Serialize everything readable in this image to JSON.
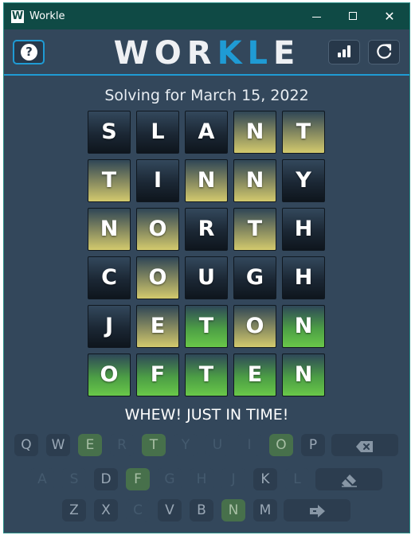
{
  "window": {
    "title": "Workle",
    "app_icon_letter": "W",
    "controls": {
      "minimize": "",
      "maximize": "",
      "close": "✕"
    }
  },
  "header": {
    "logo_part1": "WOR",
    "logo_part2": "KL",
    "logo_part3": "E",
    "help_label": "?"
  },
  "subtitle": "Solving for March 15, 2022",
  "board": {
    "rows": [
      [
        {
          "letter": "S",
          "state": "absent"
        },
        {
          "letter": "L",
          "state": "absent"
        },
        {
          "letter": "A",
          "state": "absent"
        },
        {
          "letter": "N",
          "state": "present"
        },
        {
          "letter": "T",
          "state": "present"
        }
      ],
      [
        {
          "letter": "T",
          "state": "present"
        },
        {
          "letter": "I",
          "state": "absent"
        },
        {
          "letter": "N",
          "state": "present"
        },
        {
          "letter": "N",
          "state": "present"
        },
        {
          "letter": "Y",
          "state": "absent"
        }
      ],
      [
        {
          "letter": "N",
          "state": "present"
        },
        {
          "letter": "O",
          "state": "present"
        },
        {
          "letter": "R",
          "state": "absent"
        },
        {
          "letter": "T",
          "state": "present"
        },
        {
          "letter": "H",
          "state": "absent"
        }
      ],
      [
        {
          "letter": "C",
          "state": "absent"
        },
        {
          "letter": "O",
          "state": "present"
        },
        {
          "letter": "U",
          "state": "absent"
        },
        {
          "letter": "G",
          "state": "absent"
        },
        {
          "letter": "H",
          "state": "absent"
        }
      ],
      [
        {
          "letter": "J",
          "state": "absent"
        },
        {
          "letter": "E",
          "state": "present"
        },
        {
          "letter": "T",
          "state": "correct"
        },
        {
          "letter": "O",
          "state": "present"
        },
        {
          "letter": "N",
          "state": "correct"
        }
      ],
      [
        {
          "letter": "O",
          "state": "correct"
        },
        {
          "letter": "F",
          "state": "correct"
        },
        {
          "letter": "T",
          "state": "correct"
        },
        {
          "letter": "E",
          "state": "correct"
        },
        {
          "letter": "N",
          "state": "correct"
        }
      ]
    ]
  },
  "result_message": "WHEW! JUST IN TIME!",
  "keyboard": {
    "rows": [
      [
        {
          "k": "Q",
          "s": "unused"
        },
        {
          "k": "W",
          "s": "unused"
        },
        {
          "k": "E",
          "s": "correct"
        },
        {
          "k": "R",
          "s": "absent"
        },
        {
          "k": "T",
          "s": "correct"
        },
        {
          "k": "Y",
          "s": "absent"
        },
        {
          "k": "U",
          "s": "absent"
        },
        {
          "k": "I",
          "s": "absent"
        },
        {
          "k": "O",
          "s": "correct"
        },
        {
          "k": "P",
          "s": "unused"
        }
      ],
      [
        {
          "k": "A",
          "s": "absent"
        },
        {
          "k": "S",
          "s": "absent"
        },
        {
          "k": "D",
          "s": "unused"
        },
        {
          "k": "F",
          "s": "correct"
        },
        {
          "k": "G",
          "s": "absent"
        },
        {
          "k": "H",
          "s": "absent"
        },
        {
          "k": "J",
          "s": "absent"
        },
        {
          "k": "K",
          "s": "unused"
        },
        {
          "k": "L",
          "s": "absent"
        }
      ],
      [
        {
          "k": "Z",
          "s": "unused"
        },
        {
          "k": "X",
          "s": "unused"
        },
        {
          "k": "C",
          "s": "absent"
        },
        {
          "k": "V",
          "s": "unused"
        },
        {
          "k": "B",
          "s": "unused"
        },
        {
          "k": "N",
          "s": "correct"
        },
        {
          "k": "M",
          "s": "unused"
        }
      ]
    ],
    "special_keys": {
      "backspace_icon": "backspace-icon",
      "clear_icon": "eraser-icon",
      "enter_icon": "enter-icon"
    }
  },
  "colors": {
    "background": "#33475b",
    "titlebar": "#0f4a45",
    "accent": "#1f9bd4",
    "correct": "#5fb845",
    "present": "#cfc66a",
    "absent": "#15202b"
  }
}
